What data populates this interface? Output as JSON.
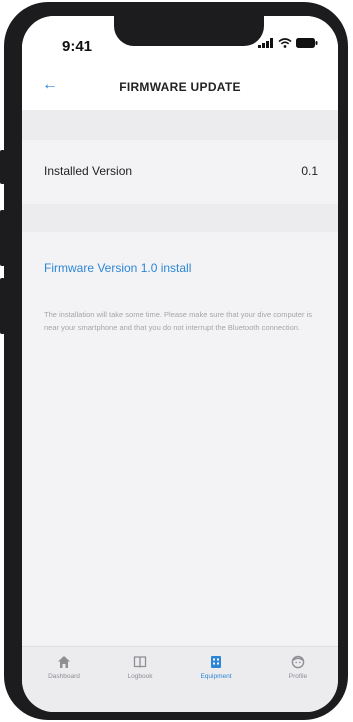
{
  "status_bar": {
    "time": "9:41"
  },
  "nav": {
    "title": "FIRMWARE UPDATE",
    "back_icon": "arrow-left-icon"
  },
  "installed": {
    "label": "Installed Version",
    "value": "0.1"
  },
  "install_link": "Firmware Version 1.0 install",
  "note": "The installation will take some time. Please make sure that your dive computer is near your smartphone and that you do not interrupt the Bluetooth connection.",
  "tabs": [
    {
      "label": "Dashboard",
      "icon": "home-icon"
    },
    {
      "label": "Logbook",
      "icon": "book-icon"
    },
    {
      "label": "Equipment",
      "icon": "equipment-icon"
    },
    {
      "label": "Profile",
      "icon": "profile-icon"
    }
  ],
  "colors": {
    "accent": "#2c86d6",
    "background": "#f3f3f5"
  }
}
